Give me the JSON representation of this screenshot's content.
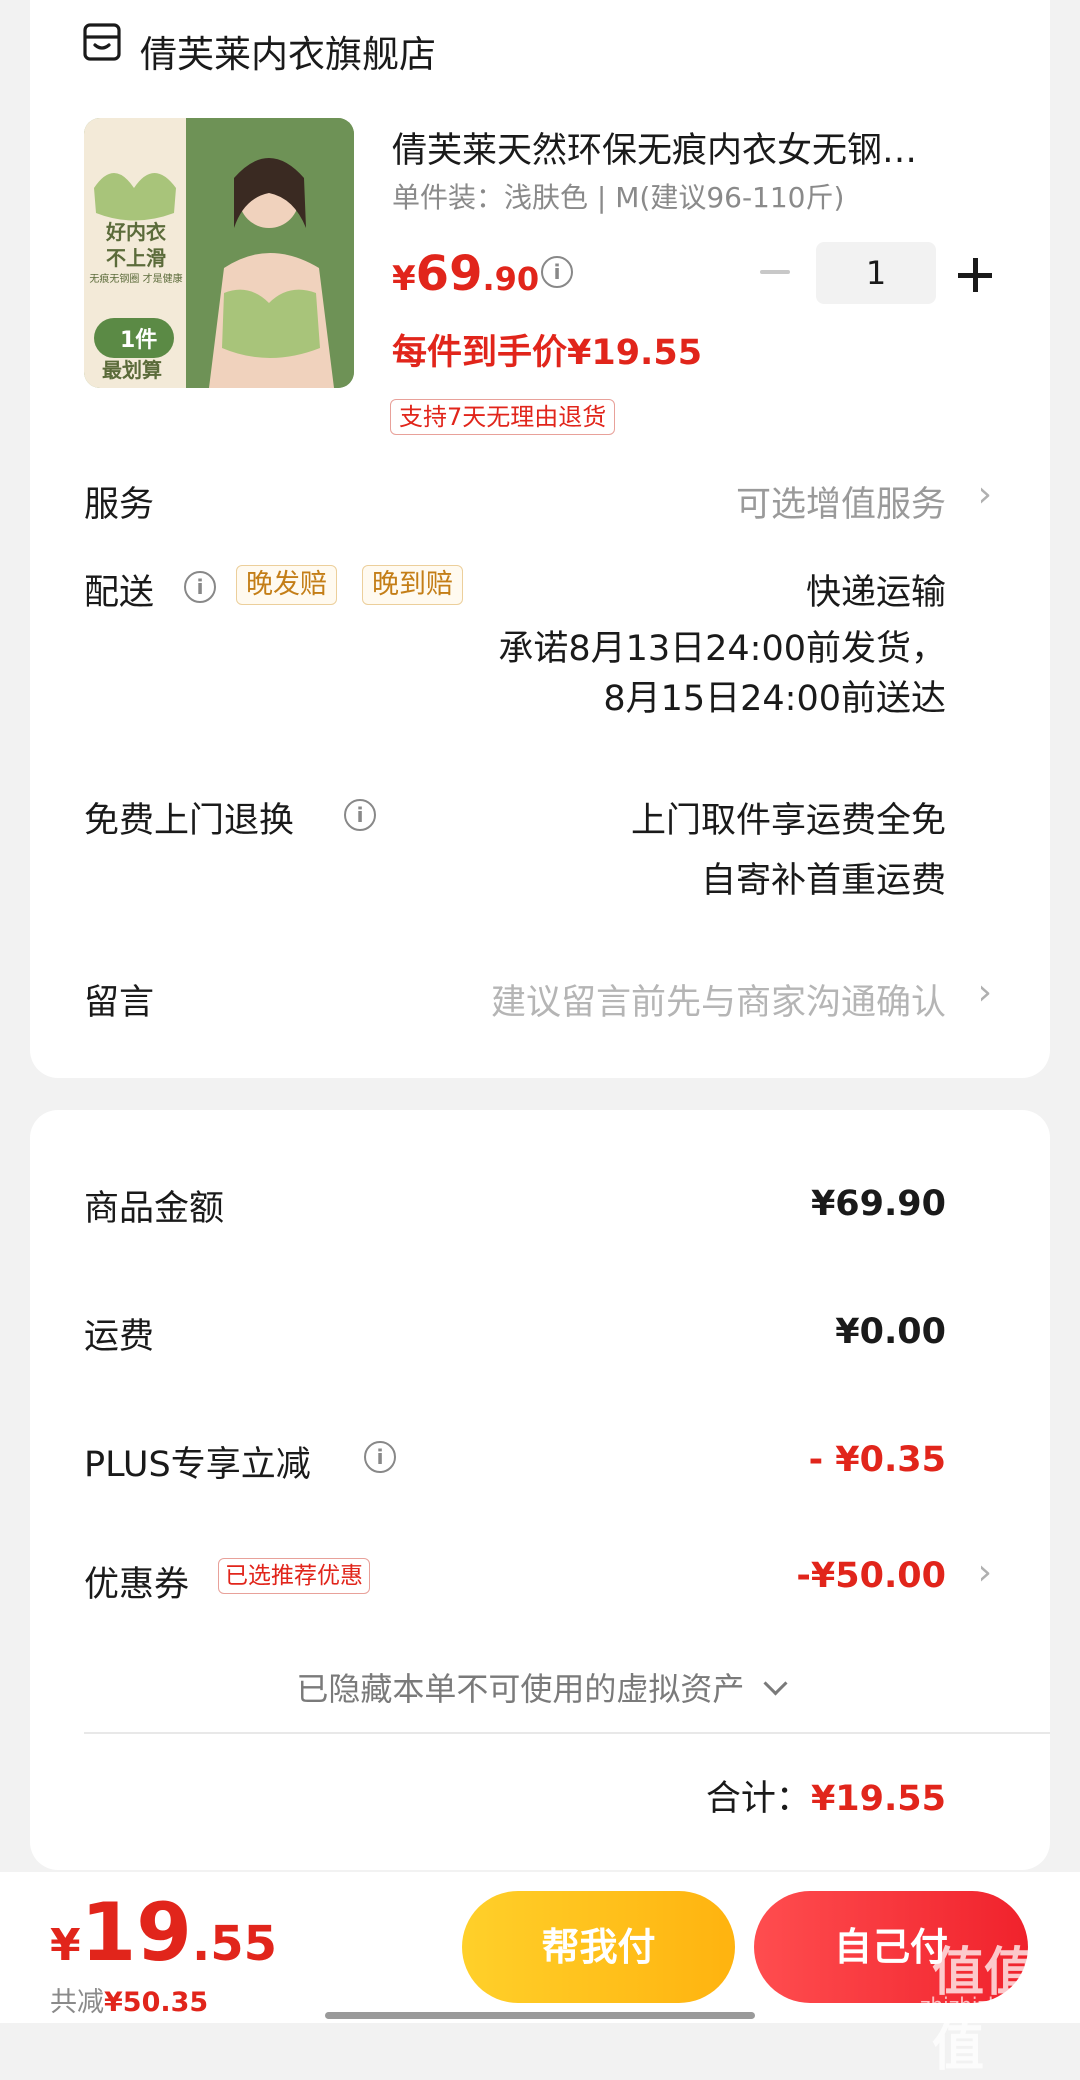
{
  "store": {
    "name": "倩芙莱内衣旗舰店",
    "icon": "store-icon"
  },
  "product": {
    "title": "倩芙莱天然环保无痕内衣女无钢…",
    "spec": "单件装：浅肤色 | M(建议96-110斤)",
    "image_text": {
      "slogan1": "好内衣",
      "slogan2": "不上滑",
      "small": "无痕无钢圈 才是健康",
      "badge": "1件",
      "badge2": "最划算"
    },
    "price_symbol": "¥",
    "price_int": "69",
    "price_dec": ".90",
    "quantity": "1",
    "unit_price": "每件到手价¥19.55",
    "return_tag": "支持7天无理由退货"
  },
  "service": {
    "label": "服务",
    "value": "可选增值服务"
  },
  "delivery": {
    "label": "配送",
    "tags": [
      "晚发赔",
      "晚到赔"
    ],
    "method": "快递运输",
    "promise_line1": "承诺8月13日24:00前发货，",
    "promise_line2": "8月15日24:00前送达"
  },
  "free_return": {
    "label": "免费上门退换",
    "line1": "上门取件享运费全免",
    "line2": "自寄补首重运费"
  },
  "message": {
    "label": "留言",
    "placeholder": "建议留言前先与商家沟通确认"
  },
  "summary": {
    "goods_label": "商品金额",
    "goods_value": "¥69.90",
    "shipping_label": "运费",
    "shipping_value": "¥0.00",
    "plus_label": "PLUS专享立减",
    "plus_value": "- ¥0.35",
    "coupon_label": "优惠券",
    "coupon_tag": "已选推荐优惠",
    "coupon_value": "-¥50.00",
    "hidden_assets": "已隐藏本单不可使用的虚拟资产",
    "total_label": "合计：",
    "total_value": "¥19.55"
  },
  "bottom": {
    "price_symbol": "¥",
    "price_int": "19",
    "price_dec": ".55",
    "saved_label": "共减",
    "saved_value": "¥50.35",
    "help_pay": "帮我付",
    "self_pay": "自己付"
  },
  "watermark": {
    "text": "值值值",
    "url": "zhizhizhi.com"
  },
  "colors": {
    "accent": "#e1251b",
    "help_button": "#ffc21a",
    "self_button": "#f0222c"
  }
}
